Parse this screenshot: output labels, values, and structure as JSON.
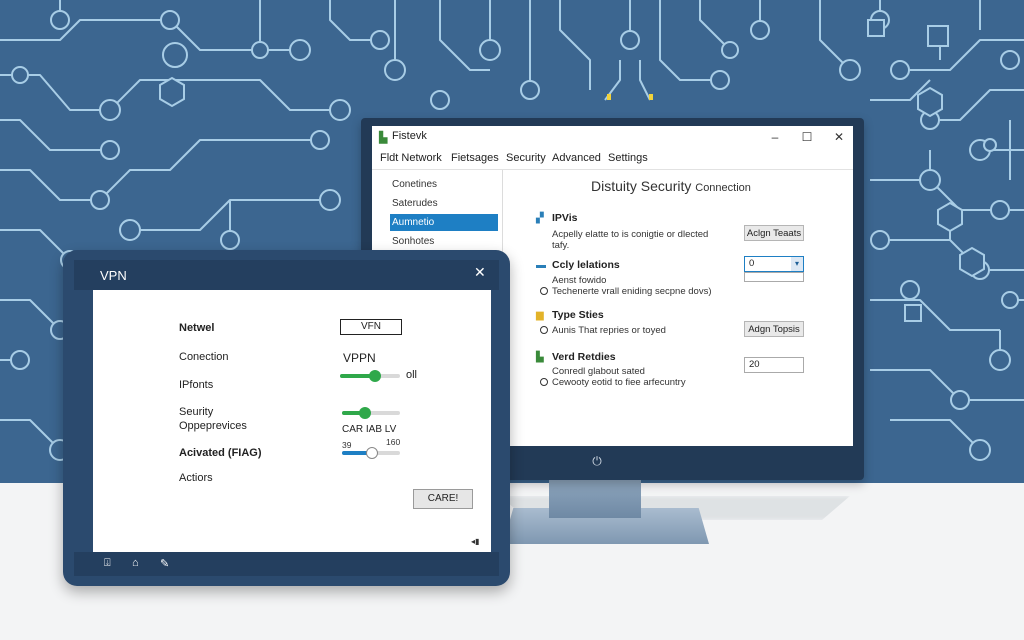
{
  "colors": {
    "background": "#3c6690",
    "circuit": "#a8cde6",
    "accent": "#1e7fc4",
    "slider_green": "#2fa84a",
    "tablet_frame": "#2b4a6e",
    "monitor_frame": "#223a56"
  },
  "monitor": {
    "window": {
      "title": "Fistevk",
      "app_icon": "network-app-icon",
      "controls": [
        "–",
        "☐",
        "✕"
      ]
    },
    "menu": [
      "Fldt Network",
      "Fietsages",
      "Security",
      "Advanced",
      "Settings"
    ],
    "sidebar": [
      "Conetines",
      "Saterudes",
      "Aumnetio",
      "Sonhotes"
    ],
    "sidebar_selected": 2,
    "content": {
      "title": "Distuity Security",
      "title_small": "Connection",
      "sections": [
        {
          "icon": "network-icon",
          "heading": "IPVis",
          "lines": [
            "Acpelly elatte to is conigtie or dlected",
            "tafy."
          ],
          "control": {
            "type": "button",
            "label": "Aclgn Teaats"
          }
        },
        {
          "icon": "folder-icon",
          "heading": "Ccly lelations",
          "lines": [
            "Aenst fowido",
            "Techenerte vrall eniding secpne dovs)"
          ],
          "control": {
            "type": "select",
            "value": "0"
          }
        },
        {
          "icon": "folder-yellow-icon",
          "heading": "Type Sties",
          "lines": [
            "Aunis That repries or toyed"
          ],
          "control": {
            "type": "button",
            "label": "Adgn Topsis"
          }
        },
        {
          "icon": "shield-icon",
          "heading": "Verd Retdies",
          "lines": [
            "Conredl glabout sated",
            "Cewooty eotid to fiee arfecuntry"
          ],
          "control": {
            "type": "field",
            "value": "20"
          }
        }
      ]
    }
  },
  "tablet": {
    "title": "VPN",
    "labels": {
      "network": "Netwel",
      "connection": "Conection",
      "iponts": "IPfonts",
      "security": "Seurity",
      "security2": "Oppeprevices",
      "advanced": "Acivated (FIAG)",
      "actions": "Actiors"
    },
    "vpn_box": "VFN",
    "vpn_label": "VPPN",
    "toggle_value": "oll",
    "slider_caption": "CAR IAB LV",
    "slider_min": "39",
    "slider_max": "160",
    "cancel_button": "CARE!",
    "sliders": {
      "vpn": 0.58,
      "security": 0.4,
      "advanced": 0.52
    },
    "nav_icons": [
      "save-icon",
      "home-icon",
      "edit-icon"
    ]
  }
}
